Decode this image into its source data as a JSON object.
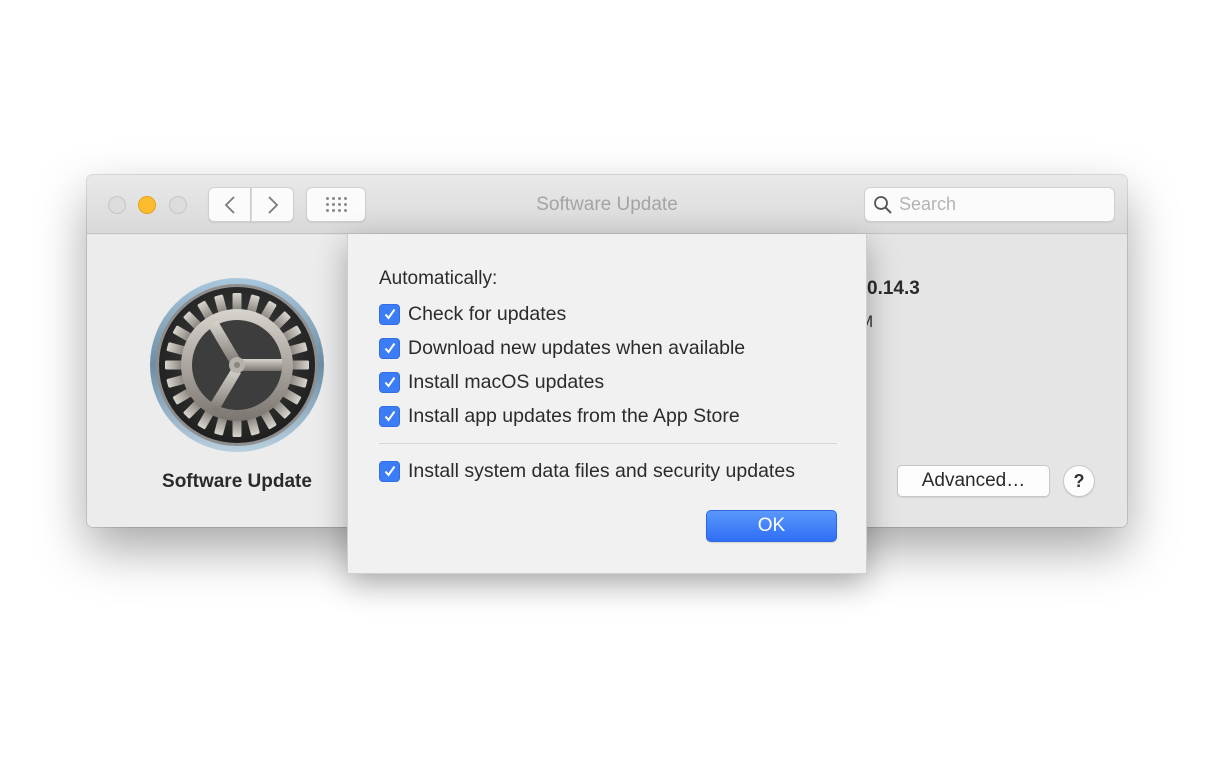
{
  "window": {
    "title": "Software Update",
    "search_placeholder": "Search",
    "search_value": ""
  },
  "toolbar": {
    "traffic_lights": [
      "close",
      "minimize",
      "zoom"
    ],
    "back_icon": "chevron-left-icon",
    "forward_icon": "chevron-right-icon",
    "show_all_icon": "grid-icon"
  },
  "pane": {
    "app_name": "Software Update",
    "version_partial": "0.14.3",
    "subtext_partial": "M",
    "advanced_label": "Advanced…",
    "help_label": "?"
  },
  "sheet": {
    "heading": "Automatically:",
    "options": [
      {
        "label": "Check for updates",
        "checked": true
      },
      {
        "label": "Download new updates when available",
        "checked": true
      },
      {
        "label": "Install macOS updates",
        "checked": true
      },
      {
        "label": "Install app updates from the App Store",
        "checked": true
      },
      {
        "label": "Install system data files and security updates",
        "checked": true
      }
    ],
    "ok_label": "OK"
  },
  "colors": {
    "accent": "#3b7cf7",
    "minimize_light": "#fdbc2e"
  }
}
